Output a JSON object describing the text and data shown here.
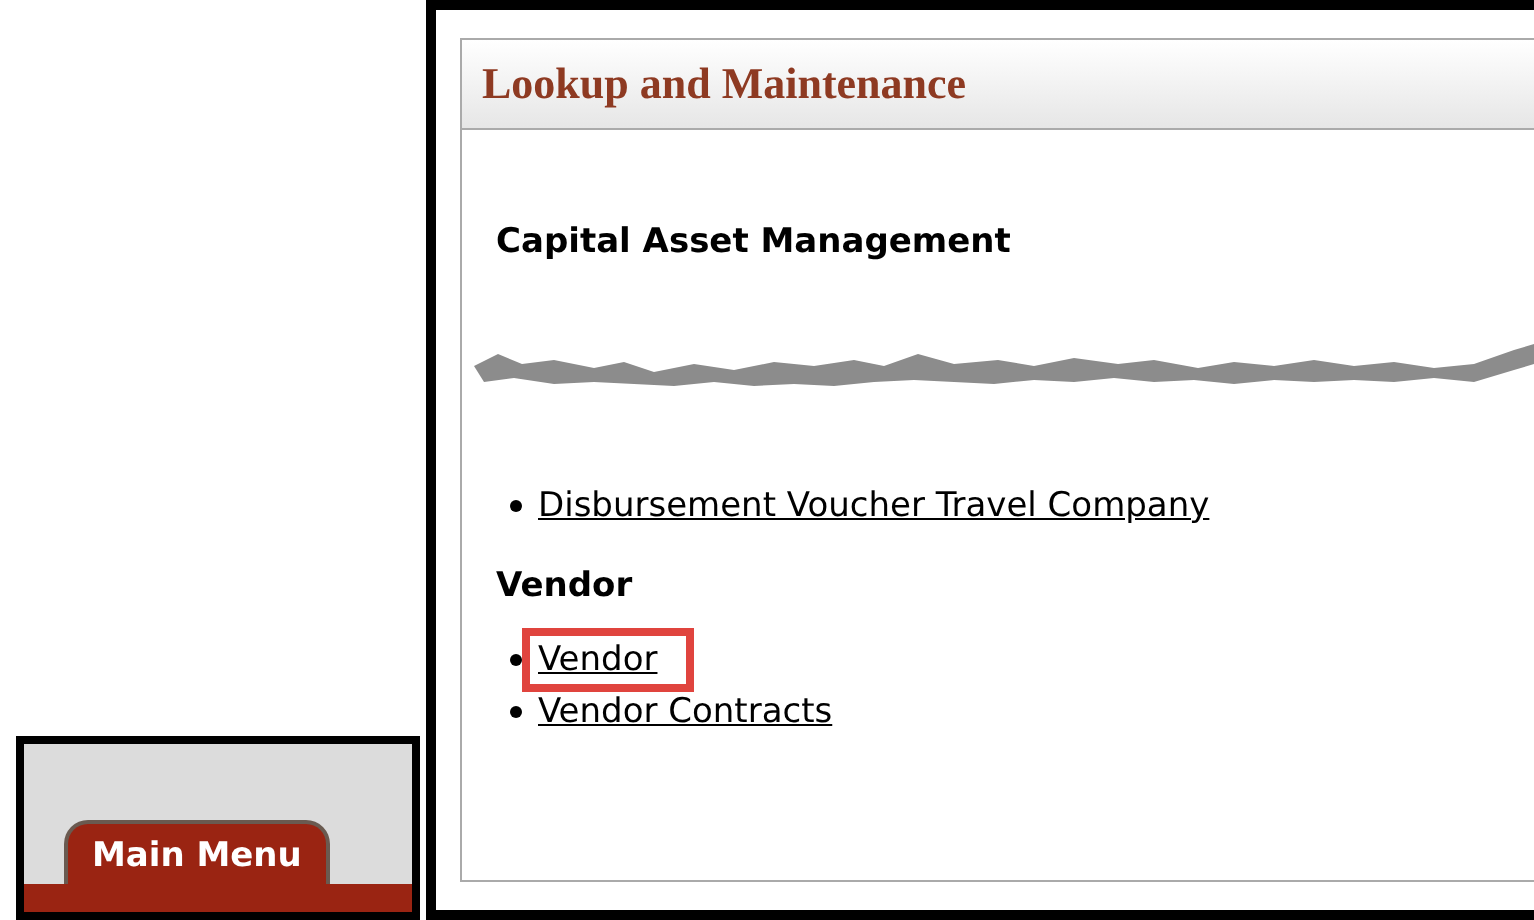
{
  "tab": {
    "label": "Main Menu",
    "selected": true
  },
  "panel": {
    "title": "Lookup and Maintenance",
    "top_sections": [
      {
        "heading": "Capital Asset Management"
      }
    ],
    "bottom_links": [
      {
        "label": "Disbursement Voucher Travel Company",
        "highlighted": false
      }
    ],
    "sections": [
      {
        "heading": "Vendor",
        "links": [
          {
            "label": "Vendor",
            "highlighted": true
          },
          {
            "label": "Vendor Contracts",
            "highlighted": false
          }
        ]
      }
    ]
  }
}
